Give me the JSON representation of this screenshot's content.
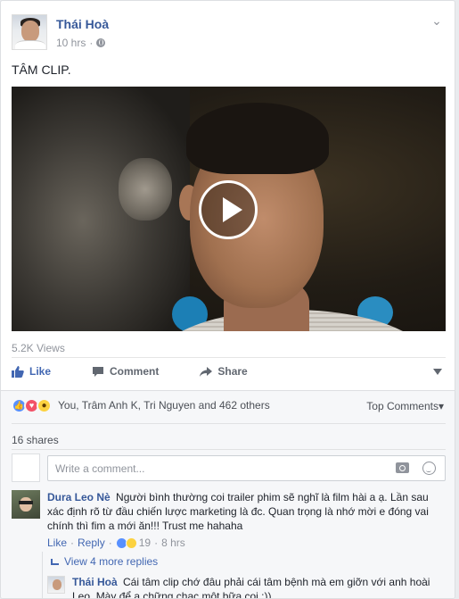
{
  "post": {
    "author": "Thái Hoà",
    "time": "10 hrs",
    "text": "TÂM CLIP.",
    "views": "5.2K Views"
  },
  "actions": {
    "like": "Like",
    "comment": "Comment",
    "share": "Share"
  },
  "reactions": {
    "summary": "You, Trâm Anh K, Tri Nguyen and 462 others",
    "sort": "Top Comments"
  },
  "shares": "16 shares",
  "comment_input": {
    "placeholder": "Write a comment..."
  },
  "comments": [
    {
      "author": "Dura Leo Nè",
      "text": "Người bình thường coi trailer phim sẽ nghĩ là film hài a ạ. Lần sau xác định rõ từ đầu chiến lược marketing là đc. Quan trọng là nhớ mời e đóng vai chính thì fim a mới ăn!!! Trust me hahaha",
      "like_label": "Like",
      "reply_label": "Reply",
      "reaction_count": "19",
      "time": "8 hrs",
      "view_replies": "View 4 more replies"
    }
  ],
  "reply": {
    "author": "Thái Hoà",
    "text": "Cái tâm clip chớ đâu phải cái tâm bệnh mà em giỡn với anh hoài Leo. Mày để a chững chạc một bữa coi :))"
  }
}
